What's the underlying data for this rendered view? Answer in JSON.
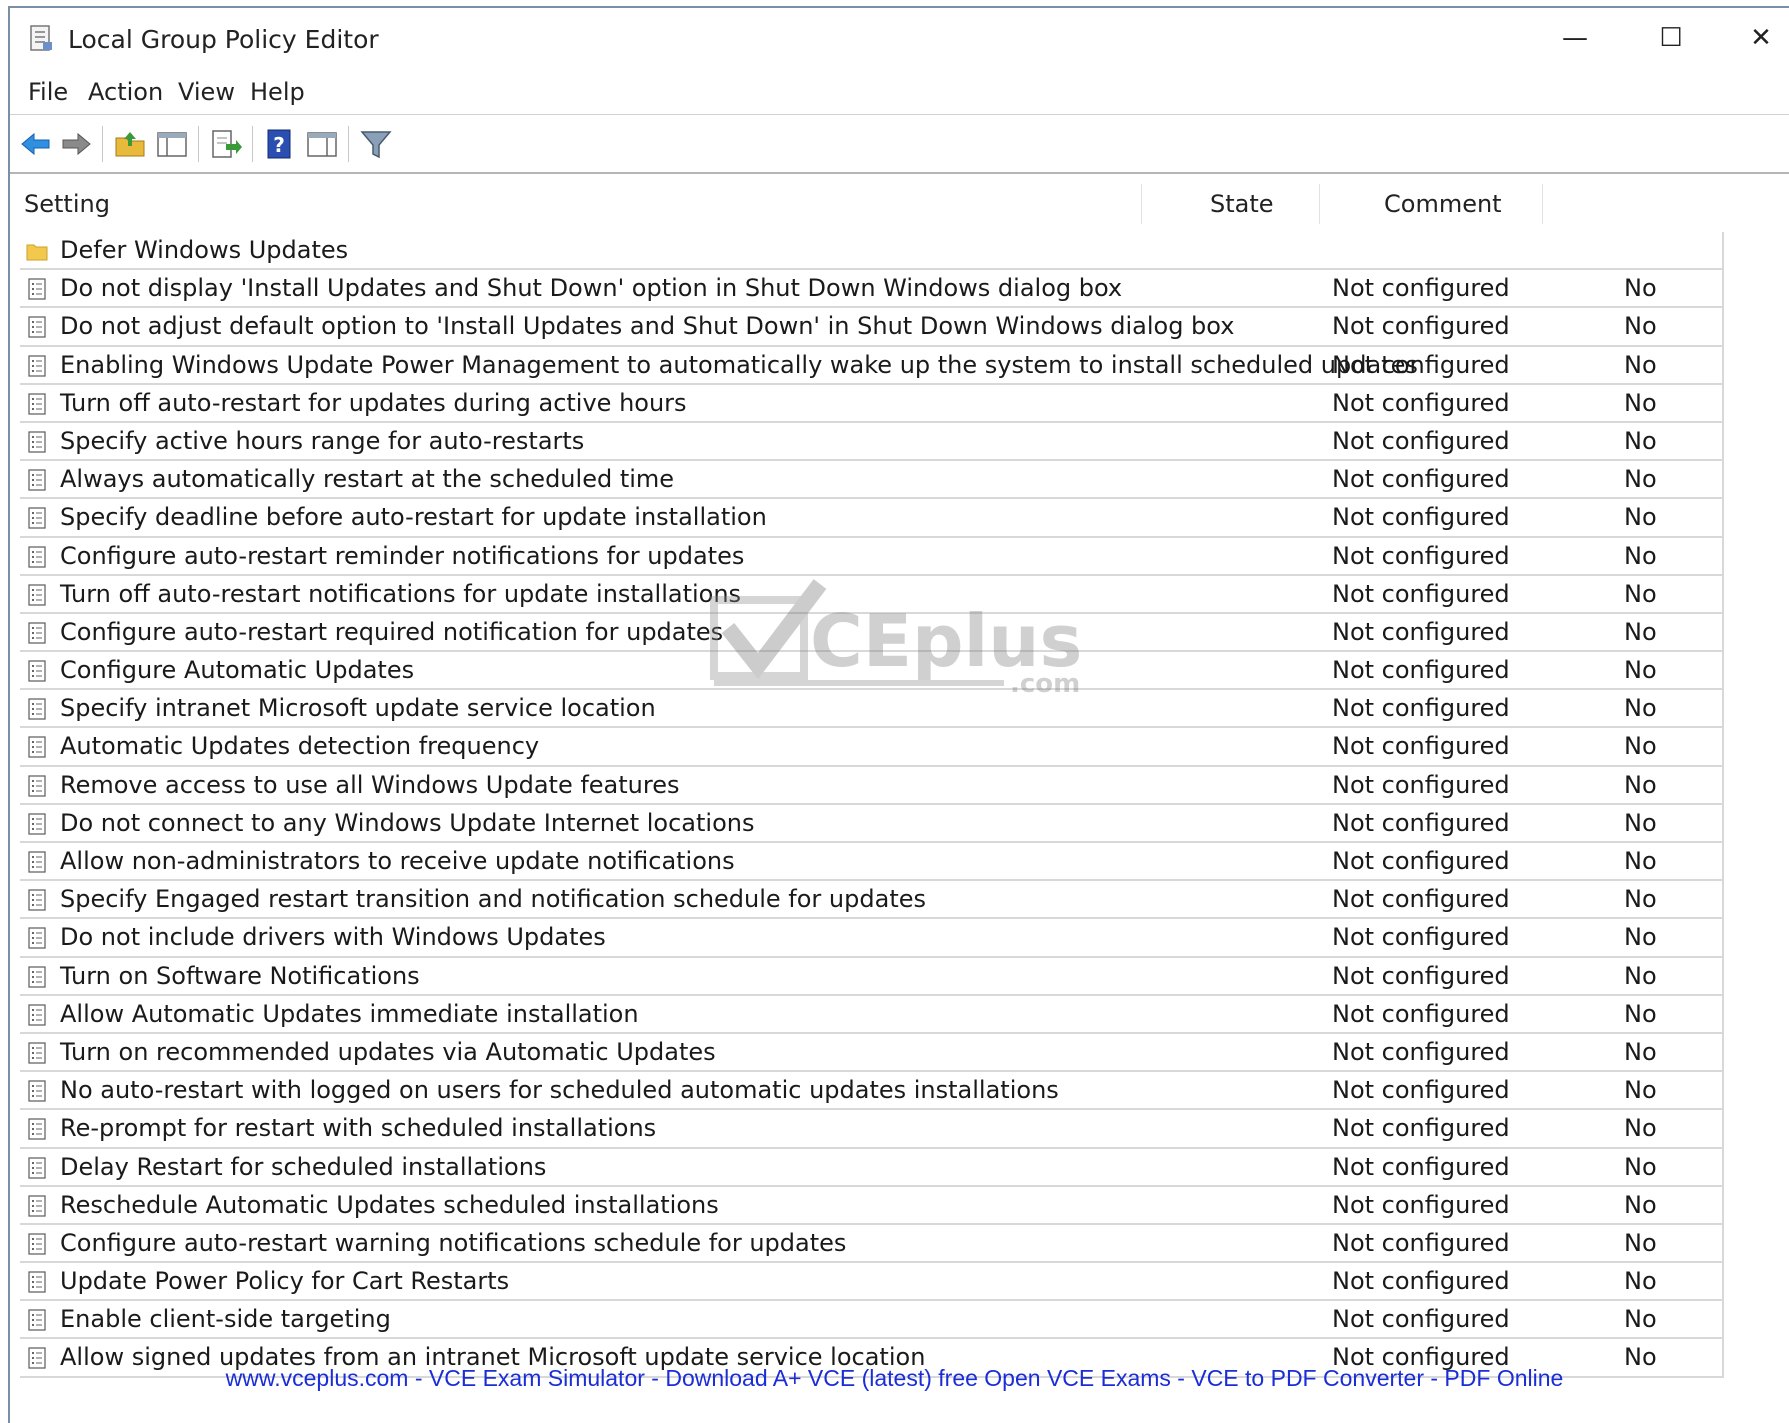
{
  "window": {
    "title": "Local Group Policy Editor",
    "minimize_glyph": "—",
    "maximize_glyph": "☐",
    "close_glyph": "✕"
  },
  "menu": {
    "file": "File",
    "action": "Action",
    "view": "View",
    "help": "Help"
  },
  "toolbar_icons": [
    "back-arrow-icon",
    "forward-arrow-icon",
    "up-folder-icon",
    "show-hide-tree-icon",
    "export-list-icon",
    "help-icon",
    "show-hide-action-pane-icon",
    "filter-icon"
  ],
  "columns": {
    "setting": "Setting",
    "state": "State",
    "comment": "Comment"
  },
  "rows": [
    {
      "type": "folder",
      "setting": "Defer Windows Updates",
      "state": "",
      "comment": ""
    },
    {
      "type": "policy",
      "setting": "Do not display 'Install Updates and Shut Down' option in Shut Down Windows dialog box",
      "state": "Not configured",
      "comment": "No"
    },
    {
      "type": "policy",
      "setting": "Do not adjust default option to 'Install Updates and Shut Down' in Shut Down Windows dialog box",
      "state": "Not configured",
      "comment": "No"
    },
    {
      "type": "policy",
      "setting": "Enabling Windows Update Power Management to automatically wake up the system to install scheduled updates",
      "state": "Not configured",
      "comment": "No"
    },
    {
      "type": "policy",
      "setting": "Turn off auto-restart for updates during active hours",
      "state": "Not configured",
      "comment": "No"
    },
    {
      "type": "policy",
      "setting": "Specify active hours range for auto-restarts",
      "state": "Not configured",
      "comment": "No"
    },
    {
      "type": "policy",
      "setting": "Always automatically restart at the scheduled time",
      "state": "Not configured",
      "comment": "No"
    },
    {
      "type": "policy",
      "setting": "Specify deadline before auto-restart for update installation",
      "state": "Not configured",
      "comment": "No"
    },
    {
      "type": "policy",
      "setting": "Configure auto-restart reminder notifications for updates",
      "state": "Not configured",
      "comment": "No"
    },
    {
      "type": "policy",
      "setting": "Turn off auto-restart notifications for update installations",
      "state": "Not configured",
      "comment": "No"
    },
    {
      "type": "policy",
      "setting": "Configure auto-restart required notification for updates",
      "state": "Not configured",
      "comment": "No"
    },
    {
      "type": "policy",
      "setting": "Configure Automatic Updates",
      "state": "Not configured",
      "comment": "No"
    },
    {
      "type": "policy",
      "setting": "Specify intranet Microsoft update service location",
      "state": "Not configured",
      "comment": "No"
    },
    {
      "type": "policy",
      "setting": "Automatic Updates detection frequency",
      "state": "Not configured",
      "comment": "No"
    },
    {
      "type": "policy",
      "setting": "Remove access to use all Windows Update features",
      "state": "Not configured",
      "comment": "No"
    },
    {
      "type": "policy",
      "setting": "Do not connect to any Windows Update Internet locations",
      "state": "Not configured",
      "comment": "No"
    },
    {
      "type": "policy",
      "setting": "Allow non-administrators to receive update notifications",
      "state": "Not configured",
      "comment": "No"
    },
    {
      "type": "policy",
      "setting": "Specify Engaged restart transition and notification schedule for updates",
      "state": "Not configured",
      "comment": "No"
    },
    {
      "type": "policy",
      "setting": "Do not include drivers with Windows Updates",
      "state": "Not configured",
      "comment": "No"
    },
    {
      "type": "policy",
      "setting": "Turn on Software Notifications",
      "state": "Not configured",
      "comment": "No"
    },
    {
      "type": "policy",
      "setting": "Allow Automatic Updates immediate installation",
      "state": "Not configured",
      "comment": "No"
    },
    {
      "type": "policy",
      "setting": "Turn on recommended updates via Automatic Updates",
      "state": "Not configured",
      "comment": "No"
    },
    {
      "type": "policy",
      "setting": "No auto-restart with logged on users for scheduled automatic updates installations",
      "state": "Not configured",
      "comment": "No"
    },
    {
      "type": "policy",
      "setting": "Re-prompt for restart with scheduled installations",
      "state": "Not configured",
      "comment": "No"
    },
    {
      "type": "policy",
      "setting": "Delay Restart for scheduled installations",
      "state": "Not configured",
      "comment": "No"
    },
    {
      "type": "policy",
      "setting": "Reschedule Automatic Updates scheduled installations",
      "state": "Not configured",
      "comment": "No"
    },
    {
      "type": "policy",
      "setting": "Configure auto-restart warning notifications schedule for updates",
      "state": "Not configured",
      "comment": "No"
    },
    {
      "type": "policy",
      "setting": "Update Power Policy for Cart Restarts",
      "state": "Not configured",
      "comment": "No"
    },
    {
      "type": "policy",
      "setting": "Enable client-side targeting",
      "state": "Not configured",
      "comment": "No"
    },
    {
      "type": "policy",
      "setting": "Allow signed updates from an intranet Microsoft update service location",
      "state": "Not configured",
      "comment": "No"
    }
  ],
  "watermark": {
    "brand": "CEplus",
    "suffix": ".com"
  },
  "footer": "www.vceplus.com - VCE Exam Simulator - Download A+ VCE (latest) free Open VCE Exams - VCE to PDF Converter - PDF Online",
  "colors": {
    "accent_blue": "#1a2dd6",
    "folder_yellow": "#f2c94c"
  }
}
